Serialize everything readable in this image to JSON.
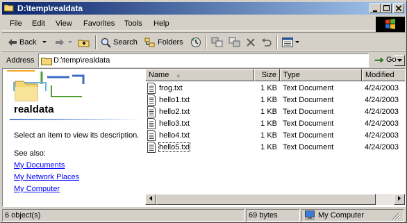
{
  "window": {
    "title": "D:\\temp\\realdata"
  },
  "menu": {
    "items": [
      "File",
      "Edit",
      "View",
      "Favorites",
      "Tools",
      "Help"
    ]
  },
  "toolbar": {
    "back_label": "Back",
    "search_label": "Search",
    "folders_label": "Folders"
  },
  "address": {
    "label": "Address",
    "value": "D:\\temp\\realdata",
    "go_label": "Go"
  },
  "leftpane": {
    "heading": "realdata",
    "description": "Select an item to view its description.",
    "see_also": "See also:",
    "links": [
      "My Documents",
      "My Network Places",
      "My Computer"
    ]
  },
  "filelist": {
    "columns": {
      "name": "Name",
      "size": "Size",
      "type": "Type",
      "modified": "Modified"
    },
    "rows": [
      {
        "name": "frog.txt",
        "size": "1 KB",
        "type": "Text Document",
        "modified": "4/24/2003"
      },
      {
        "name": "hello1.txt",
        "size": "1 KB",
        "type": "Text Document",
        "modified": "4/24/2003"
      },
      {
        "name": "hello2.txt",
        "size": "1 KB",
        "type": "Text Document",
        "modified": "4/24/2003"
      },
      {
        "name": "hello3.txt",
        "size": "1 KB",
        "type": "Text Document",
        "modified": "4/24/2003"
      },
      {
        "name": "hello4.txt",
        "size": "1 KB",
        "type": "Text Document",
        "modified": "4/24/2003"
      },
      {
        "name": "hello5.txt",
        "size": "1 KB",
        "type": "Text Document",
        "modified": "4/24/2003"
      }
    ]
  },
  "status": {
    "objects": "6 object(s)",
    "size": "69 bytes",
    "zone": "My Computer"
  },
  "colors": {
    "titlebar_start": "#0a246a",
    "titlebar_end": "#a6caf0",
    "chrome": "#d4d0c8",
    "link": "#0000ff"
  }
}
